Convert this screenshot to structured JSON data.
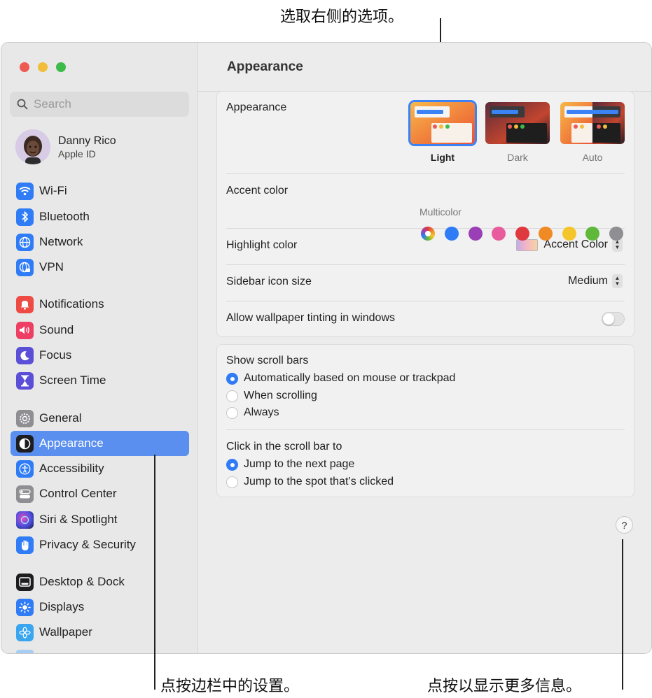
{
  "callouts": {
    "top": "选取右侧的选项。",
    "bottom_left": "点按边栏中的设置。",
    "bottom_right": "点按以显示更多信息。"
  },
  "sidebar": {
    "search_placeholder": "Search",
    "profile": {
      "name": "Danny Rico",
      "subtitle": "Apple ID"
    },
    "items": [
      {
        "label": "Wi-Fi",
        "icon": "wifi-icon",
        "color": "#2f7cf6"
      },
      {
        "label": "Bluetooth",
        "icon": "bluetooth-icon",
        "color": "#2f7cf6"
      },
      {
        "label": "Network",
        "icon": "globe-icon",
        "color": "#2f7cf6"
      },
      {
        "label": "VPN",
        "icon": "vpn-globe-icon",
        "color": "#2f7cf6"
      },
      {
        "label": "Notifications",
        "icon": "bell-icon",
        "color": "#ee4b44"
      },
      {
        "label": "Sound",
        "icon": "speaker-icon",
        "color": "#ee3e63"
      },
      {
        "label": "Focus",
        "icon": "moon-icon",
        "color": "#5b4fd8"
      },
      {
        "label": "Screen Time",
        "icon": "hourglass-icon",
        "color": "#5b4fd8"
      },
      {
        "label": "General",
        "icon": "gear-icon",
        "color": "#8e8e93"
      },
      {
        "label": "Appearance",
        "icon": "appearance-icon",
        "color": "#1d1d1f"
      },
      {
        "label": "Accessibility",
        "icon": "accessibility-icon",
        "color": "#2f7cf6"
      },
      {
        "label": "Control Center",
        "icon": "control-center-icon",
        "color": "#8e8e93"
      },
      {
        "label": "Siri & Spotlight",
        "icon": "siri-icon",
        "color": "#6b3fd6"
      },
      {
        "label": "Privacy & Security",
        "icon": "hand-icon",
        "color": "#2f7cf6"
      },
      {
        "label": "Desktop & Dock",
        "icon": "dock-icon",
        "color": "#1d1d1f"
      },
      {
        "label": "Displays",
        "icon": "sun-icon",
        "color": "#2f7cf6"
      },
      {
        "label": "Wallpaper",
        "icon": "flower-icon",
        "color": "#3aa6f0"
      }
    ]
  },
  "main": {
    "title": "Appearance",
    "appearance": {
      "label": "Appearance",
      "options": [
        "Light",
        "Dark",
        "Auto"
      ],
      "selected": "Light"
    },
    "accent": {
      "label": "Accent color",
      "colors": [
        "#2f7cf6",
        "#9a3fb5",
        "#e85c9e",
        "#e0383f",
        "#f08a24",
        "#f5c62b",
        "#5fb83a",
        "#8e8e93"
      ],
      "multicolor_label": "Multicolor"
    },
    "highlight": {
      "label": "Highlight color",
      "value": "Accent Color"
    },
    "sidebar_icon_size": {
      "label": "Sidebar icon size",
      "value": "Medium"
    },
    "wallpaper_tinting": {
      "label": "Allow wallpaper tinting in windows",
      "on": false
    },
    "scroll_bars": {
      "label": "Show scroll bars",
      "options": [
        "Automatically based on mouse or trackpad",
        "When scrolling",
        "Always"
      ]
    },
    "click_scroll": {
      "label": "Click in the scroll bar to",
      "options": [
        "Jump to the next page",
        "Jump to the spot that’s clicked"
      ]
    },
    "help": "?"
  }
}
